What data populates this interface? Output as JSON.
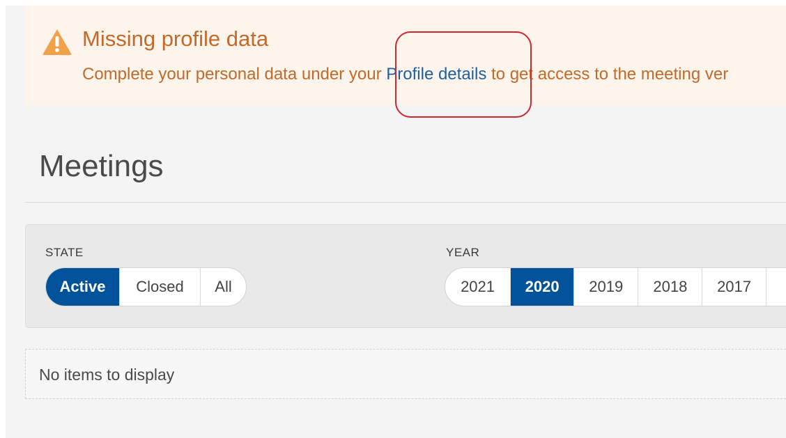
{
  "alert": {
    "icon": "warning-triangle-icon",
    "title": "Missing profile data",
    "message_before": "Complete your personal data under your ",
    "link_text": "Profile details",
    "message_after": " to get access to the meeting ver",
    "colors": {
      "background": "#fdf4ec",
      "text": "#c26a2a",
      "link": "#1f5f9e",
      "icon": "#f0a14a"
    }
  },
  "page": {
    "title": "Meetings"
  },
  "filters": {
    "state": {
      "label": "STATE",
      "options": [
        "Active",
        "Closed",
        "All"
      ],
      "selected": "Active"
    },
    "year": {
      "label": "YEAR",
      "options": [
        "2021",
        "2020",
        "2019",
        "2018",
        "2017",
        ""
      ],
      "selected": "2020"
    },
    "accent_color": "#00539b"
  },
  "results": {
    "empty_message": "No items to display"
  },
  "annotation": {
    "highlight_color": "#d1252e"
  }
}
